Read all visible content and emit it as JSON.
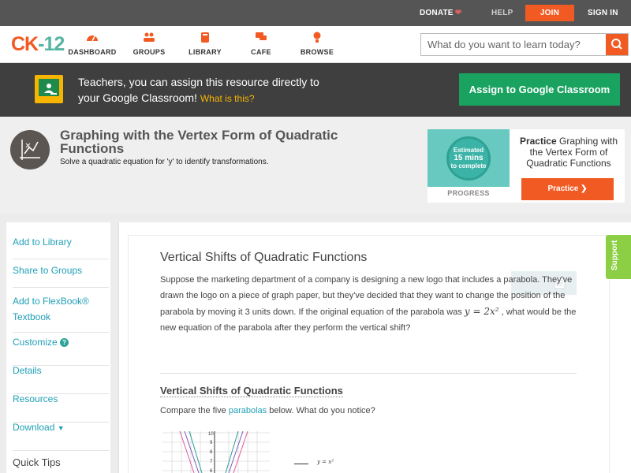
{
  "topbar": {
    "donate": "DONATE",
    "help": "HELP",
    "join": "JOIN",
    "signin": "SIGN IN"
  },
  "nav": {
    "logo_ck": "CK",
    "logo_dash": "-",
    "logo_num": "12",
    "items": [
      {
        "label": "DASHBOARD",
        "icon": "dashboard-icon"
      },
      {
        "label": "GROUPS",
        "icon": "groups-icon"
      },
      {
        "label": "LIBRARY",
        "icon": "library-icon"
      },
      {
        "label": "CAFE",
        "icon": "cafe-icon"
      },
      {
        "label": "BROWSE",
        "icon": "browse-icon"
      }
    ],
    "search_placeholder": "What do you want to learn today?"
  },
  "classroom": {
    "line1": "Teachers, you can assign this resource directly to",
    "line2": "your Google Classroom!",
    "what": "What is this?",
    "button": "Assign to Google Classroom"
  },
  "header": {
    "title": "Graphing with the Vertex Form of Quadratic Functions",
    "subtitle": "Solve a quadratic equation for 'y' to identify transformations.",
    "practice": {
      "circle_line1": "Estimated",
      "circle_line2": "15 mins",
      "circle_line3": "to complete",
      "progress": "PROGRESS",
      "bold": "Practice",
      "text": " Graphing with the Vertex Form of Quadratic Functions",
      "button": "Practice"
    }
  },
  "sidebar": {
    "items": [
      {
        "label": "Add to Library"
      },
      {
        "label": "Share to Groups"
      },
      {
        "label": "Add to FlexBook® Textbook"
      },
      {
        "label": "Customize"
      },
      {
        "label": "Details"
      },
      {
        "label": "Resources"
      },
      {
        "label": "Download"
      }
    ],
    "quick_tips": "Quick Tips"
  },
  "content": {
    "heading": "Vertical Shifts of Quadratic Functions",
    "para_a": "Suppose the marketing department of a company is designing a new logo that includes a parabola. They've drawn the logo on a piece of graph paper, but they've decided that they want to change the position of the parabola by moving it 3 units down. If the original equation of the parabola was ",
    "math": "y = 2x²",
    "para_b": " , what would be the new equation of the parabola after they perform the vertical shift?",
    "subheading": "Vertical Shifts of Quadratic Functions",
    "compare_a": "Compare the five ",
    "compare_link": "parabolas",
    "compare_b": " below. What do you notice?",
    "legend1": "y = x²",
    "graph_ticks": [
      "10",
      "9",
      "8",
      "7",
      "6"
    ]
  },
  "support": "Support",
  "colors": {
    "accent": "#f15a22",
    "teal": "#1f9fb6",
    "google_green": "#1aa260",
    "support_green": "#8ccf45"
  }
}
